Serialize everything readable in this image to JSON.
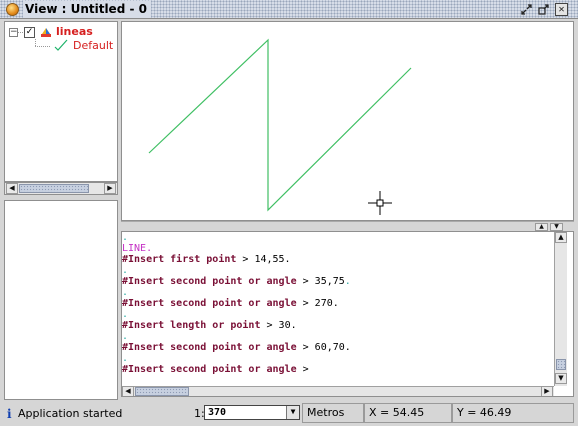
{
  "window": {
    "title": "View : Untitled - 0",
    "buttons": [
      "restore",
      "maximize",
      "close"
    ],
    "close_glyph": "✕"
  },
  "toc": {
    "expander_glyph": "−",
    "checked_glyph": "✓",
    "layer": {
      "name": "lineas",
      "checked": true,
      "icon": "layer-lines-icon"
    },
    "legend": {
      "label": "Default",
      "icon": "line-symbol-icon",
      "color": "#1db36a"
    }
  },
  "map": {
    "line_color": "#3fbf63",
    "cursor": "crosshair-icon"
  },
  "console": {
    "lines": [
      {
        "type": "dot",
        "text": "."
      },
      {
        "type": "cmd",
        "text": "LINE."
      },
      {
        "type": "prompt",
        "prompt": "#Insert first point",
        "sep": " > ",
        "value": "14,55."
      },
      {
        "type": "dot",
        "text": "."
      },
      {
        "type": "prompt",
        "prompt": "#Insert second point or angle",
        "sep": " > ",
        "value": "35,75",
        "tail": "."
      },
      {
        "type": "dot",
        "text": "."
      },
      {
        "type": "prompt",
        "prompt": "#Insert second point or angle",
        "sep": " > ",
        "value": "270."
      },
      {
        "type": "dot",
        "text": "."
      },
      {
        "type": "prompt",
        "prompt": "#Insert length or point",
        "sep": " > ",
        "value": "30."
      },
      {
        "type": "dot",
        "text": "."
      },
      {
        "type": "prompt",
        "prompt": "#Insert second point or angle",
        "sep": " > ",
        "value": "60,70."
      },
      {
        "type": "dot",
        "text": "."
      },
      {
        "type": "prompt",
        "prompt": "#Insert second point or angle",
        "sep": " >",
        "value": ""
      }
    ]
  },
  "statusbar": {
    "info_glyph": "i",
    "message": "Application started",
    "scale_label": "1:",
    "scale_value": "370",
    "dropdown_glyph": "▼",
    "units": "Metros",
    "x": "X = 54.45",
    "y": "Y = 46.49"
  },
  "scroll_glyphs": {
    "left": "◀",
    "right": "▶",
    "up": "▲",
    "down": "▼"
  }
}
